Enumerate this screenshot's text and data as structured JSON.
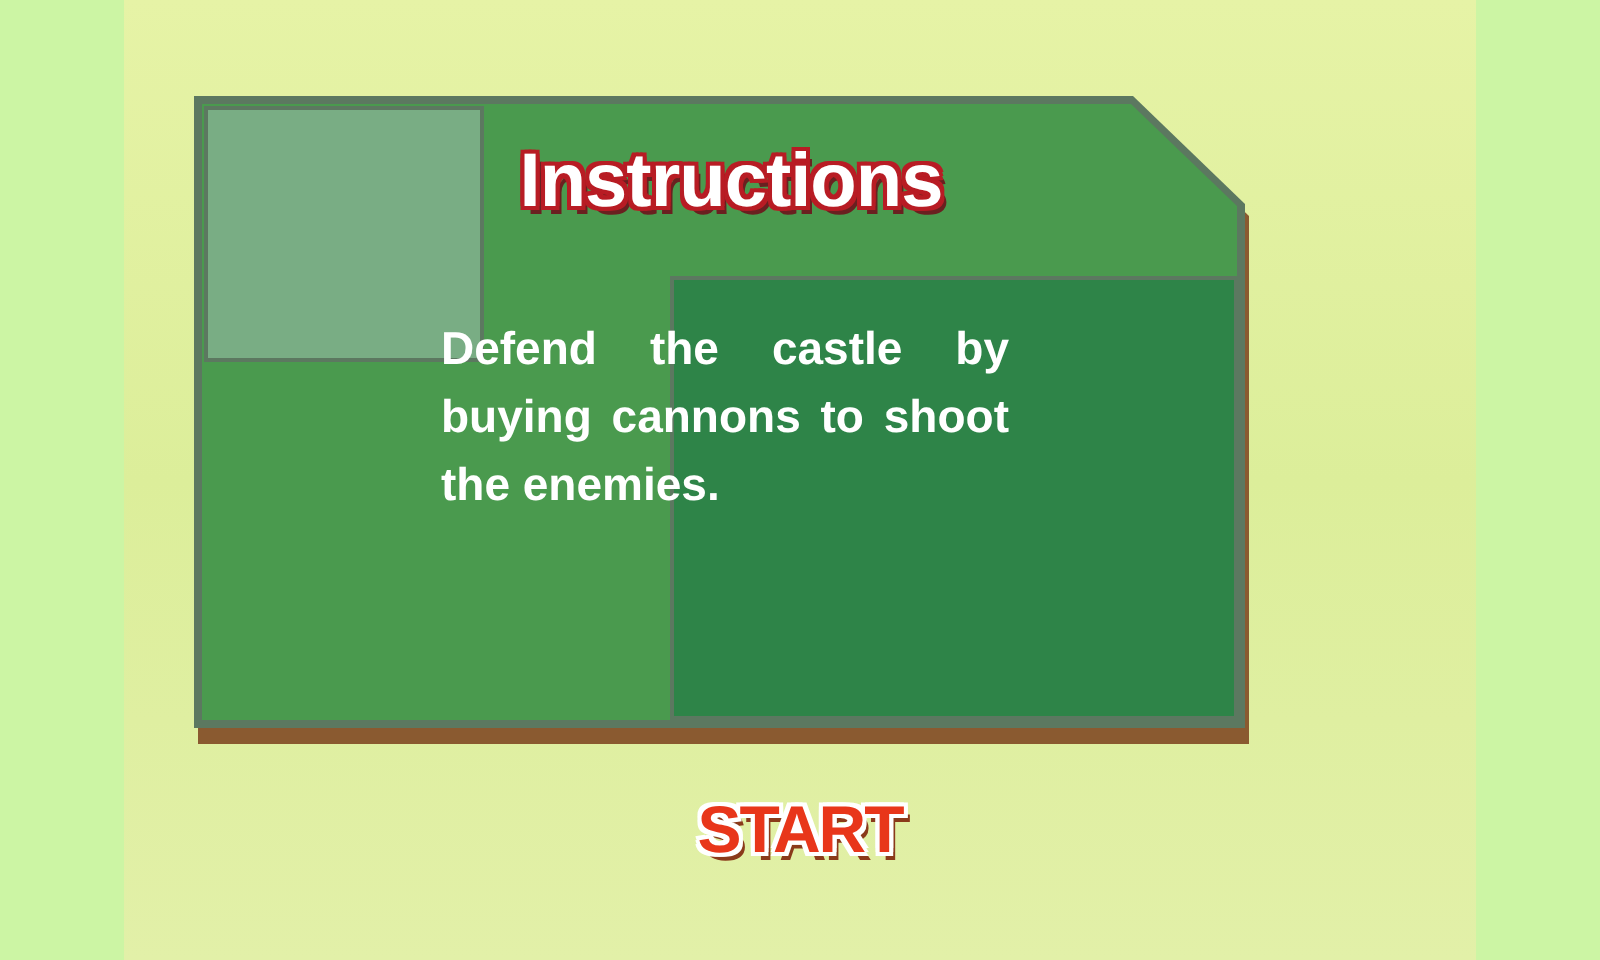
{
  "title": "Instructions",
  "body": "Defend the castle by buying cannons to shoot the enemies.",
  "start_button": "START"
}
